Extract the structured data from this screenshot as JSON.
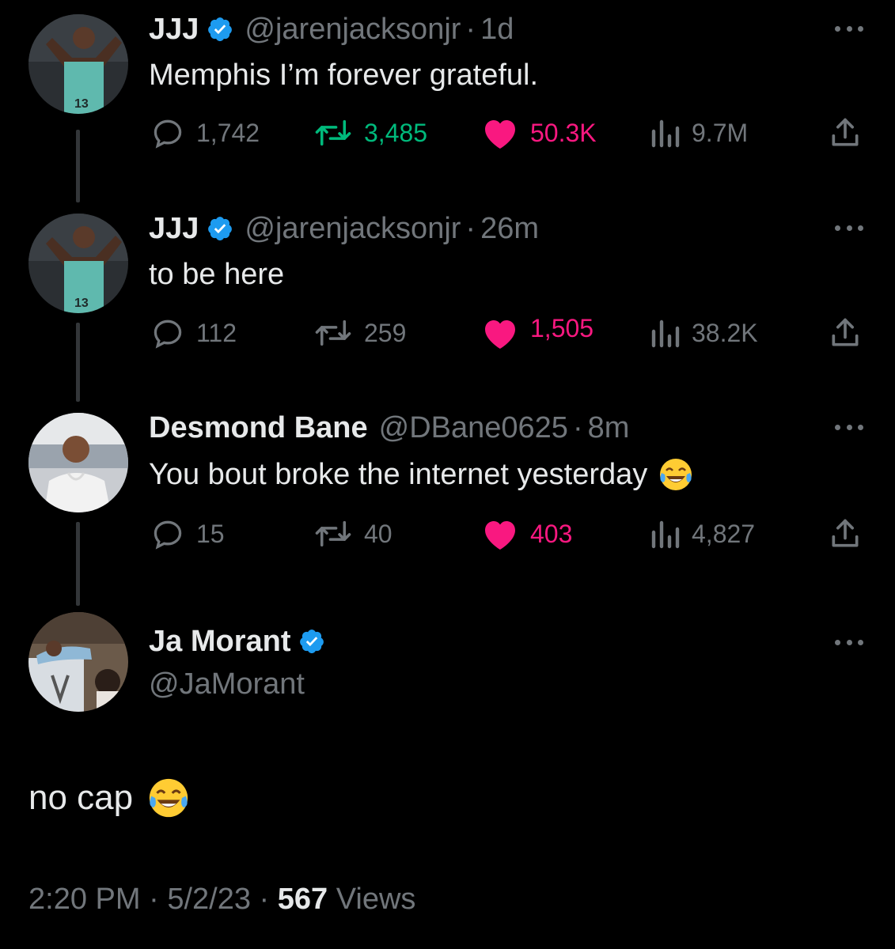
{
  "colors": {
    "background": "#000000",
    "text": "#e7e9ea",
    "muted": "#71767b",
    "verified": "#1d9bf0",
    "retweet_active": "#00ba7c",
    "like_active": "#f91880"
  },
  "tweets": [
    {
      "name": "JJJ",
      "handle": "@jarenjacksonjr",
      "time": "1d",
      "text": "Memphis I’m forever grateful.",
      "replies": "1,742",
      "retweets": "3,485",
      "likes": "50.3K",
      "views": "9.7M",
      "avatar_icon": "jersey-13-avatar"
    },
    {
      "name": "JJJ",
      "handle": "@jarenjacksonjr",
      "time": "26m",
      "text": "to be here",
      "replies": "112",
      "retweets": "259",
      "likes": "1,505",
      "views": "38.2K",
      "avatar_icon": "jersey-13-avatar"
    },
    {
      "name": "Desmond Bane",
      "handle": "@DBane0625",
      "time": "8m",
      "text": "You bout broke the internet yesterday",
      "replies": "15",
      "retweets": "40",
      "likes": "403",
      "views": "4,827",
      "avatar_icon": "portrait-avatar",
      "emoji": "tears-of-joy-emoji"
    }
  ],
  "main_tweet": {
    "name": "Ja Morant",
    "handle": "@JaMorant",
    "text": "no cap",
    "emoji": "tears-of-joy-emoji",
    "time": "2:20 PM",
    "date": "5/2/23",
    "views_count": "567",
    "views_label": "Views",
    "sep": "·"
  },
  "sep": "·"
}
